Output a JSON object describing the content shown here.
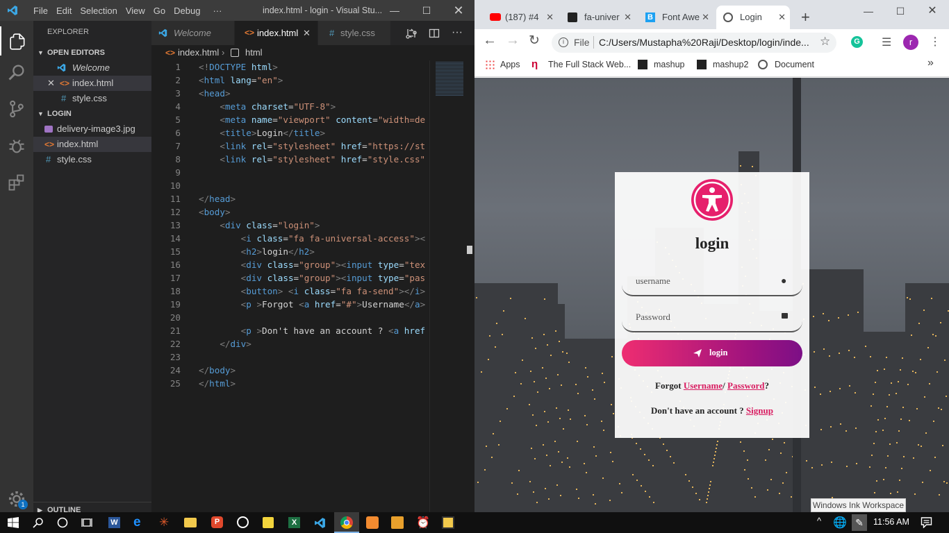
{
  "vscode": {
    "menu": [
      "File",
      "Edit",
      "Selection",
      "View",
      "Go",
      "Debug",
      "···"
    ],
    "window_title": "index.html - login - Visual Stu...",
    "explorer_header": "EXPLORER",
    "open_editors_header": "OPEN EDITORS",
    "open_editors": [
      "Welcome",
      "index.html",
      "style.css"
    ],
    "project_header": "LOGIN",
    "files": [
      "delivery-image3.jpg",
      "index.html",
      "style.css"
    ],
    "outline_header": "OUTLINE",
    "tabs": [
      "Welcome",
      "index.html",
      "style.css"
    ],
    "breadcrumb_file": "index.html",
    "breadcrumb_symbol": "html",
    "settings_badge": "1",
    "code_lines": [
      [
        [
          "pu",
          "<!"
        ],
        [
          "tg",
          "DOCTYPE "
        ],
        [
          "at",
          "html"
        ],
        [
          "pu",
          ">"
        ]
      ],
      [
        [
          "pu",
          "<"
        ],
        [
          "tg",
          "html "
        ],
        [
          "at",
          "lang"
        ],
        [
          "tx",
          "="
        ],
        [
          "st",
          "\"en\""
        ],
        [
          "pu",
          ">"
        ]
      ],
      [
        [
          "pu",
          "<"
        ],
        [
          "tg",
          "head"
        ],
        [
          "pu",
          ">"
        ]
      ],
      [
        [
          "tx",
          "    "
        ],
        [
          "pu",
          "<"
        ],
        [
          "tg",
          "meta "
        ],
        [
          "at",
          "charset"
        ],
        [
          "tx",
          "="
        ],
        [
          "st",
          "\"UTF-8\""
        ],
        [
          "pu",
          ">"
        ]
      ],
      [
        [
          "tx",
          "    "
        ],
        [
          "pu",
          "<"
        ],
        [
          "tg",
          "meta "
        ],
        [
          "at",
          "name"
        ],
        [
          "tx",
          "="
        ],
        [
          "st",
          "\"viewport\" "
        ],
        [
          "at",
          "content"
        ],
        [
          "tx",
          "="
        ],
        [
          "st",
          "\"width=de"
        ]
      ],
      [
        [
          "tx",
          "    "
        ],
        [
          "pu",
          "<"
        ],
        [
          "tg",
          "title"
        ],
        [
          "pu",
          ">"
        ],
        [
          "tx",
          "Login"
        ],
        [
          "pu",
          "</"
        ],
        [
          "tg",
          "title"
        ],
        [
          "pu",
          ">"
        ]
      ],
      [
        [
          "tx",
          "    "
        ],
        [
          "pu",
          "<"
        ],
        [
          "tg",
          "link "
        ],
        [
          "at",
          "rel"
        ],
        [
          "tx",
          "="
        ],
        [
          "st",
          "\"stylesheet\" "
        ],
        [
          "at",
          "href"
        ],
        [
          "tx",
          "="
        ],
        [
          "st",
          "\"https://st"
        ]
      ],
      [
        [
          "tx",
          "    "
        ],
        [
          "pu",
          "<"
        ],
        [
          "tg",
          "link "
        ],
        [
          "at",
          "rel"
        ],
        [
          "tx",
          "="
        ],
        [
          "st",
          "\"stylesheet\" "
        ],
        [
          "at",
          "href"
        ],
        [
          "tx",
          "="
        ],
        [
          "st",
          "\"style.css\""
        ]
      ],
      [],
      [],
      [
        [
          "pu",
          "</"
        ],
        [
          "tg",
          "head"
        ],
        [
          "pu",
          ">"
        ]
      ],
      [
        [
          "pu",
          "<"
        ],
        [
          "tg",
          "body"
        ],
        [
          "pu",
          ">"
        ]
      ],
      [
        [
          "tx",
          "    "
        ],
        [
          "pu",
          "<"
        ],
        [
          "tg",
          "div "
        ],
        [
          "at",
          "class"
        ],
        [
          "tx",
          "="
        ],
        [
          "st",
          "\"login\""
        ],
        [
          "pu",
          ">"
        ]
      ],
      [
        [
          "tx",
          "        "
        ],
        [
          "pu",
          "<"
        ],
        [
          "tg",
          "i "
        ],
        [
          "at",
          "class"
        ],
        [
          "tx",
          "="
        ],
        [
          "st",
          "\"fa fa-universal-access\""
        ],
        [
          "pu",
          "><"
        ]
      ],
      [
        [
          "tx",
          "        "
        ],
        [
          "pu",
          "<"
        ],
        [
          "tg",
          "h2"
        ],
        [
          "pu",
          ">"
        ],
        [
          "tx",
          "login"
        ],
        [
          "pu",
          "</"
        ],
        [
          "tg",
          "h2"
        ],
        [
          "pu",
          ">"
        ]
      ],
      [
        [
          "tx",
          "        "
        ],
        [
          "pu",
          "<"
        ],
        [
          "tg",
          "div "
        ],
        [
          "at",
          "class"
        ],
        [
          "tx",
          "="
        ],
        [
          "st",
          "\"group\""
        ],
        [
          "pu",
          "><"
        ],
        [
          "tg",
          "input "
        ],
        [
          "at",
          "type"
        ],
        [
          "tx",
          "="
        ],
        [
          "st",
          "\"tex"
        ]
      ],
      [
        [
          "tx",
          "        "
        ],
        [
          "pu",
          "<"
        ],
        [
          "tg",
          "div "
        ],
        [
          "at",
          "class"
        ],
        [
          "tx",
          "="
        ],
        [
          "st",
          "\"group\""
        ],
        [
          "pu",
          "><"
        ],
        [
          "tg",
          "input "
        ],
        [
          "at",
          "type"
        ],
        [
          "tx",
          "="
        ],
        [
          "st",
          "\"pas"
        ]
      ],
      [
        [
          "tx",
          "        "
        ],
        [
          "pu",
          "<"
        ],
        [
          "tg",
          "button"
        ],
        [
          "pu",
          "> <"
        ],
        [
          "tg",
          "i "
        ],
        [
          "at",
          "class"
        ],
        [
          "tx",
          "="
        ],
        [
          "st",
          "\"fa fa-send\""
        ],
        [
          "pu",
          "></"
        ],
        [
          "tg",
          "i"
        ],
        [
          "pu",
          ">"
        ]
      ],
      [
        [
          "tx",
          "        "
        ],
        [
          "pu",
          "<"
        ],
        [
          "tg",
          "p "
        ],
        [
          "pu",
          ">"
        ],
        [
          "tx",
          "Forgot "
        ],
        [
          "pu",
          "<"
        ],
        [
          "tg",
          "a "
        ],
        [
          "at",
          "href"
        ],
        [
          "tx",
          "="
        ],
        [
          "st",
          "\"#\""
        ],
        [
          "pu",
          ">"
        ],
        [
          "tx",
          "Username"
        ],
        [
          "pu",
          "</"
        ],
        [
          "tg",
          "a"
        ],
        [
          "pu",
          ">"
        ]
      ],
      [],
      [
        [
          "tx",
          "        "
        ],
        [
          "pu",
          "<"
        ],
        [
          "tg",
          "p "
        ],
        [
          "pu",
          ">"
        ],
        [
          "tx",
          "Don't have an account ? "
        ],
        [
          "pu",
          "<"
        ],
        [
          "tg",
          "a "
        ],
        [
          "at",
          "href"
        ]
      ],
      [
        [
          "tx",
          "    "
        ],
        [
          "pu",
          "</"
        ],
        [
          "tg",
          "div"
        ],
        [
          "pu",
          ">"
        ]
      ],
      [],
      [
        [
          "pu",
          "</"
        ],
        [
          "tg",
          "body"
        ],
        [
          "pu",
          ">"
        ]
      ],
      [
        [
          "pu",
          "</"
        ],
        [
          "tg",
          "html"
        ],
        [
          "pu",
          ">"
        ]
      ]
    ]
  },
  "chrome": {
    "tabs": [
      "(187) #4",
      "fa-univer",
      "Font Awe",
      "Login"
    ],
    "url_scheme": "File",
    "url": "C:/Users/Mustapha%20Raji/Desktop/login/inde...",
    "avatar_letter": "r",
    "bookmarks": [
      "Apps",
      "The Full Stack Web...",
      "mashup",
      "mashup2",
      "Document"
    ],
    "more": "»"
  },
  "login_page": {
    "title": "login",
    "username_placeholder": "username",
    "password_placeholder": "Password",
    "button_label": "login",
    "forgot_prefix": "Forgot ",
    "forgot_username": "Username",
    "forgot_sep": "/ ",
    "forgot_password": "Password",
    "forgot_suffix": "?",
    "signup_prefix": "Don't have an account ? ",
    "signup_link": "Signup",
    "accent": "#e6206c"
  },
  "taskbar": {
    "ink_tooltip": "Windows Ink Workspace",
    "time": "11:56 AM"
  }
}
